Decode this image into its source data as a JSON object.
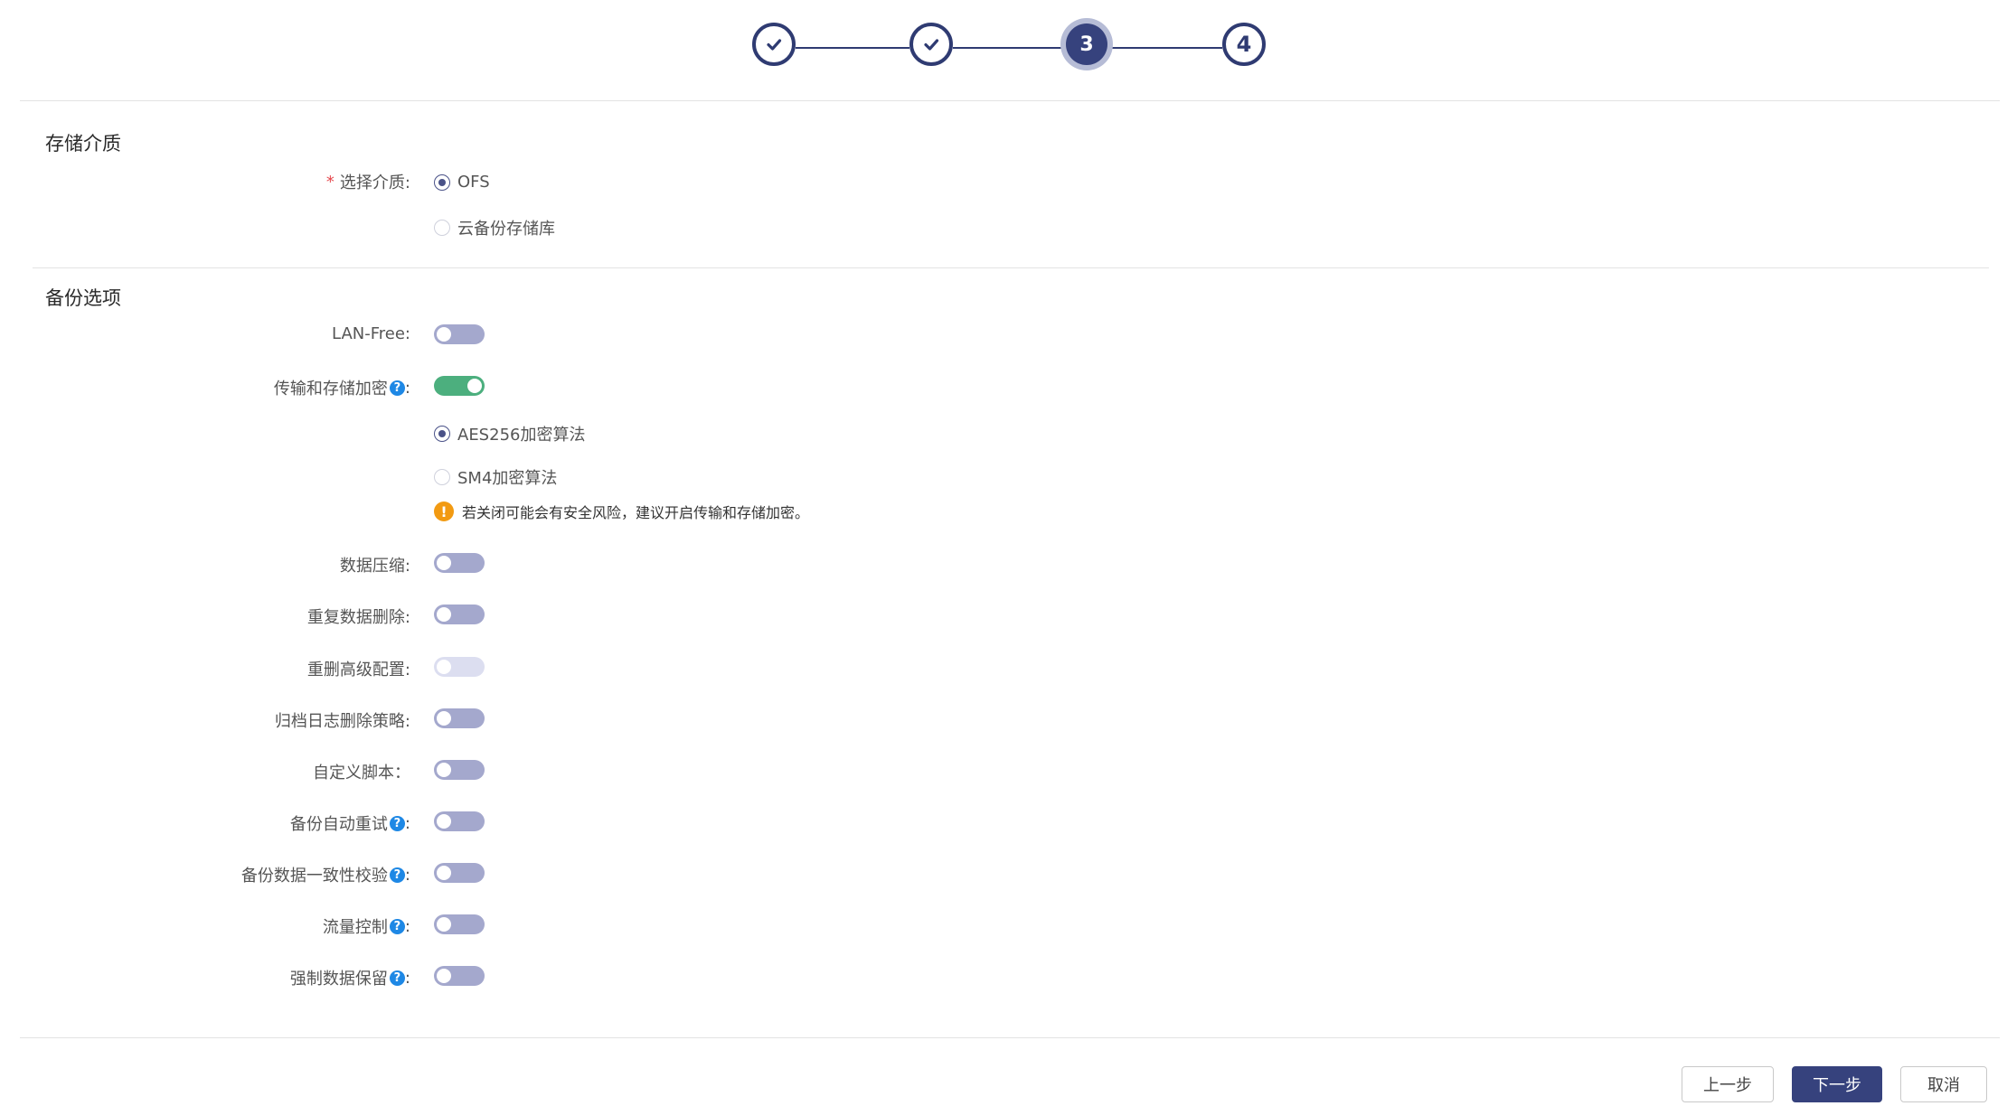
{
  "stepper": {
    "steps": [
      {
        "state": "done",
        "icon": "check-icon"
      },
      {
        "state": "done",
        "icon": "check-icon"
      },
      {
        "state": "active",
        "label": "3"
      },
      {
        "state": "pending",
        "label": "4"
      }
    ]
  },
  "storage": {
    "title": "存储介质",
    "media_label": "选择介质:",
    "required_mark": "*",
    "options": [
      {
        "label": "OFS",
        "checked": true
      },
      {
        "label": "云备份存储库",
        "checked": false
      }
    ]
  },
  "backup": {
    "title": "备份选项",
    "lan_free": {
      "label": "LAN-Free:",
      "on": false
    },
    "encryption": {
      "label": "传输和存储加密",
      "colon": ":",
      "on": true
    },
    "algorithms": [
      {
        "label": "AES256加密算法",
        "checked": true
      },
      {
        "label": "SM4加密算法",
        "checked": false
      }
    ],
    "warning_icon": "!",
    "warning_text": "若关闭可能会有安全风险，建议开启传输和存储加密。",
    "compression": {
      "label": "数据压缩:",
      "on": false
    },
    "dedup": {
      "label": "重复数据删除:",
      "on": false
    },
    "dedup_advanced": {
      "label": "重删高级配置:",
      "on": false,
      "disabled": true
    },
    "archive_log": {
      "label": "归档日志删除策略:",
      "on": false
    },
    "custom_script": {
      "label": "自定义脚本：",
      "on": false
    },
    "auto_retry": {
      "label": "备份自动重试",
      "colon": ":",
      "on": false
    },
    "consistency": {
      "label": "备份数据一致性校验",
      "colon": ":",
      "on": false
    },
    "flow_control": {
      "label": "流量控制",
      "colon": ":",
      "on": false
    },
    "force_retain": {
      "label": "强制数据保留",
      "colon": ":",
      "on": false
    },
    "help_icon": "?"
  },
  "footer": {
    "prev_label": "上一步",
    "next_label": "下一步",
    "cancel_label": "取消"
  },
  "colors": {
    "primary": "#36427d",
    "toggle_off": "#a4a8cd",
    "toggle_on": "#4caf7e",
    "warning": "#f29a12",
    "help": "#1e88e5",
    "required": "#e5484d"
  }
}
